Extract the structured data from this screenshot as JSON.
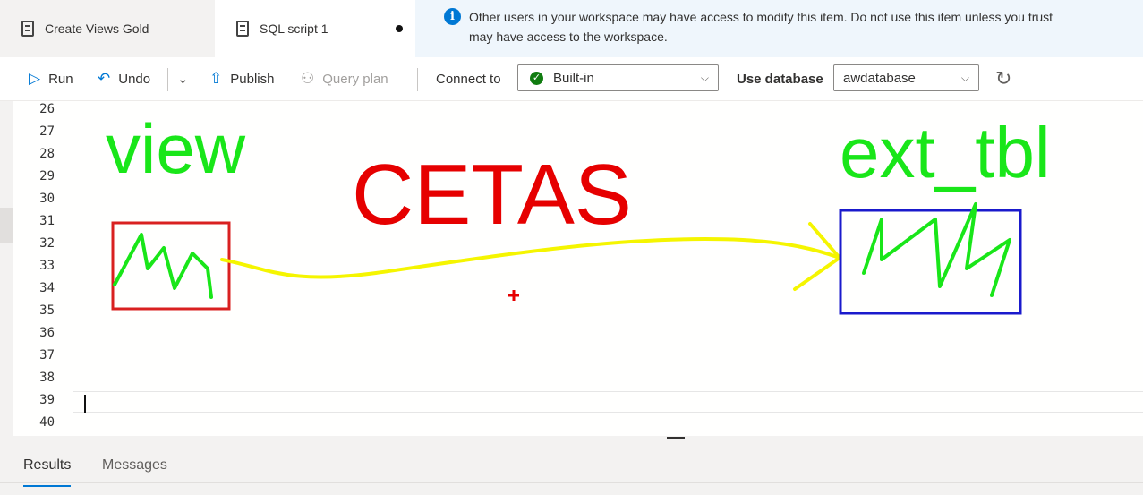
{
  "tabs": [
    {
      "label": "Create Views Gold",
      "icon": "sql-script-icon"
    },
    {
      "label": "SQL script 1",
      "icon": "sql-script-icon",
      "unsaved": true
    }
  ],
  "info_banner": {
    "line1": "Other users in your workspace may have access to modify this item. Do not use this item unless you trust",
    "line2": "may have access to the workspace.",
    "icon": "info-icon"
  },
  "toolbar": {
    "run": "Run",
    "undo": "Undo",
    "publish": "Publish",
    "query_plan": "Query plan",
    "connect_to_label": "Connect to",
    "connect_to_value": "Built-in",
    "use_database_label": "Use database",
    "use_database_value": "awdatabase"
  },
  "editor": {
    "line_numbers": [
      "26",
      "27",
      "28",
      "29",
      "30",
      "31",
      "32",
      "33",
      "34",
      "35",
      "36",
      "37",
      "38",
      "39",
      "40"
    ],
    "current_line": "39"
  },
  "annotations": {
    "left_label": "view",
    "center_label": "CETAS",
    "right_label": "ext_tbl",
    "colors": {
      "green": "#19e619",
      "red": "#e60000",
      "yellow": "#f5f500",
      "blue": "#1a1acc",
      "box_red": "#d92020"
    }
  },
  "bottom_tabs": {
    "results": "Results",
    "messages": "Messages"
  }
}
